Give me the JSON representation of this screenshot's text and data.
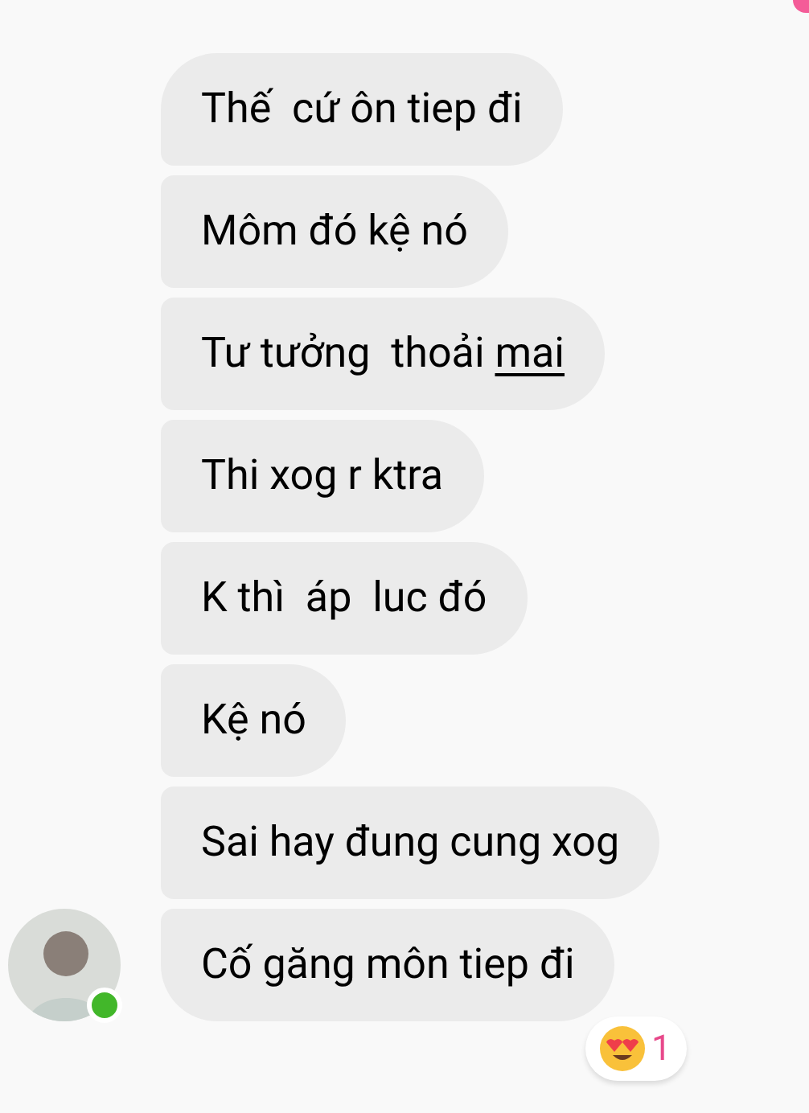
{
  "previous_message": {
    "kind": "outgoing",
    "cut_off": true
  },
  "messages": [
    {
      "parts": [
        {
          "text": "Thế  cứ ôn tiep đi",
          "underlined": false
        }
      ]
    },
    {
      "parts": [
        {
          "text": "Môm đó kệ nó",
          "underlined": false
        }
      ]
    },
    {
      "parts": [
        {
          "text": "Tư tưởng  thoải ",
          "underlined": false
        },
        {
          "text": "mai",
          "underlined": true
        }
      ]
    },
    {
      "parts": [
        {
          "text": "Thi xog r ktra",
          "underlined": false
        }
      ]
    },
    {
      "parts": [
        {
          "text": "K thì  áp  luc đó",
          "underlined": false
        }
      ]
    },
    {
      "parts": [
        {
          "text": "Kệ nó",
          "underlined": false
        }
      ]
    },
    {
      "parts": [
        {
          "text": "Sai hay đung cung xog",
          "underlined": false
        }
      ]
    },
    {
      "parts": [
        {
          "text": "Cố găng môn tiep đi",
          "underlined": false
        }
      ]
    }
  ],
  "sender": {
    "online": true
  },
  "reaction": {
    "count": "1"
  }
}
